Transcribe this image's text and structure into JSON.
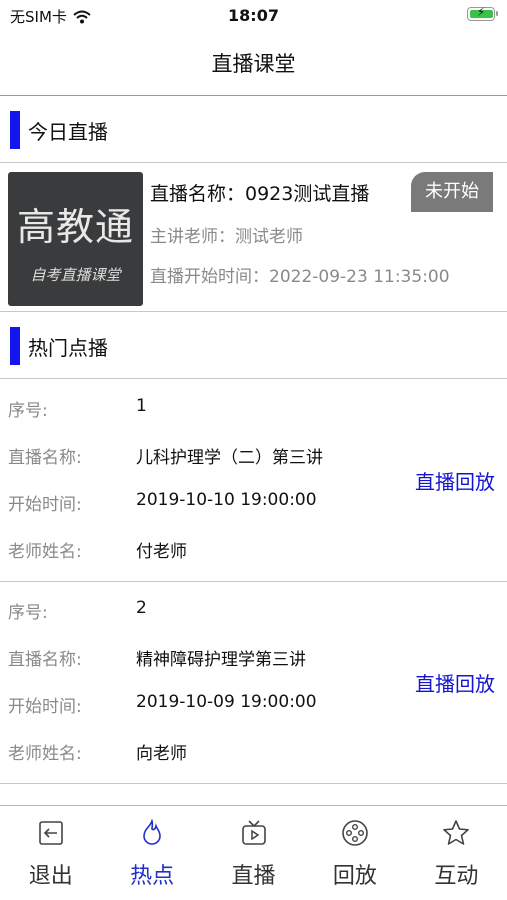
{
  "status_bar": {
    "carrier": "无SIM卡",
    "time": "18:07"
  },
  "nav": {
    "title": "直播课堂"
  },
  "today_live": {
    "section_title": "今日直播",
    "thumbnail": {
      "big_text": "高教通",
      "small_text": "自考直播课堂"
    },
    "name": "直播名称：0923测试直播",
    "teacher": "主讲老师：测试老师",
    "start_time": "直播开始时间：2022-09-23 11:35:00",
    "status": "未开始"
  },
  "hot_vod": {
    "section_title": "热门点播",
    "labels": {
      "index": "序号:",
      "name": "直播名称:",
      "start": "开始时间:",
      "teacher": "老师姓名:"
    },
    "items": [
      {
        "index": "1",
        "name": "儿科护理学（二）第三讲",
        "start": "2019-10-10 19:00:00",
        "teacher": "付老师",
        "action": "直播回放"
      },
      {
        "index": "2",
        "name": "精神障碍护理学第三讲",
        "start": "2019-10-09 19:00:00",
        "teacher": "向老师",
        "action": "直播回放"
      }
    ]
  },
  "tabbar": {
    "active": "热点",
    "active_color": "#2030c8",
    "items": [
      {
        "label": "退出",
        "icon": "exit-icon"
      },
      {
        "label": "热点",
        "icon": "flame-icon"
      },
      {
        "label": "直播",
        "icon": "tv-icon"
      },
      {
        "label": "回放",
        "icon": "film-reel-icon"
      },
      {
        "label": "互动",
        "icon": "star-icon"
      }
    ]
  }
}
